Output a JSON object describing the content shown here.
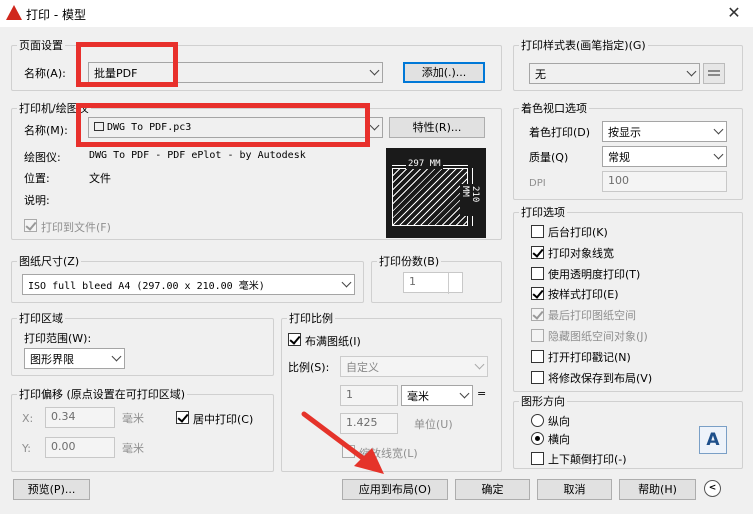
{
  "window": {
    "title": "打印 - 模型",
    "close": "✕"
  },
  "page_setup": {
    "group_label": "页面设置",
    "name_label": "名称(A):",
    "name_value": "批量PDF",
    "add_button": "添加(.)..."
  },
  "printer": {
    "group_label": "打印机/绘图仪",
    "name_label": "名称(M):",
    "name_value": "DWG To PDF.pc3",
    "properties_button": "特性(R)...",
    "plotter_label": "绘图仪:",
    "plotter_value": "DWG To PDF - PDF ePlot - by Autodesk",
    "location_label": "位置:",
    "location_value": "文件",
    "description_label": "说明:",
    "print_to_file": "打印到文件(F)",
    "preview_width": "297 MM",
    "preview_height": "210 MM"
  },
  "paper_size": {
    "group_label": "图纸尺寸(Z)",
    "value": "ISO full bleed A4 (297.00 x 210.00 毫米)"
  },
  "copies": {
    "group_label": "打印份数(B)",
    "value": "1"
  },
  "plot_area": {
    "group_label": "打印区域",
    "range_label": "打印范围(W):",
    "range_value": "图形界限"
  },
  "plot_offset": {
    "group_label": "打印偏移 (原点设置在可打印区域)",
    "x_label": "X:",
    "x_value": "0.34",
    "x_unit": "毫米",
    "y_label": "Y:",
    "y_value": "0.00",
    "y_unit": "毫米",
    "center_plot": "居中打印(C)"
  },
  "plot_scale": {
    "group_label": "打印比例",
    "fit_to_paper": "布满图纸(I)",
    "scale_label": "比例(S):",
    "scale_value": "自定义",
    "value1": "1",
    "unit_value": "毫米",
    "equals": "=",
    "value2": "1.425",
    "unit_label": "单位(U)",
    "scale_lineweights": "缩放线宽(L)"
  },
  "plot_style": {
    "group_label": "打印样式表(画笔指定)(G)",
    "value": "无"
  },
  "shaded_viewport": {
    "group_label": "着色视口选项",
    "shade_label": "着色打印(D)",
    "shade_value": "按显示",
    "quality_label": "质量(Q)",
    "quality_value": "常规",
    "dpi_label": "DPI",
    "dpi_value": "100"
  },
  "plot_options": {
    "group_label": "打印选项",
    "items": [
      {
        "label": "后台打印(K)",
        "checked": false,
        "enabled": true
      },
      {
        "label": "打印对象线宽",
        "checked": true,
        "enabled": true
      },
      {
        "label": "使用透明度打印(T)",
        "checked": false,
        "enabled": true
      },
      {
        "label": "按样式打印(E)",
        "checked": true,
        "enabled": true
      },
      {
        "label": "最后打印图纸空间",
        "checked": true,
        "enabled": false
      },
      {
        "label": "隐藏图纸空间对象(J)",
        "checked": false,
        "enabled": false
      },
      {
        "label": "打开打印戳记(N)",
        "checked": false,
        "enabled": true
      },
      {
        "label": "将修改保存到布局(V)",
        "checked": false,
        "enabled": true
      }
    ]
  },
  "orientation": {
    "group_label": "图形方向",
    "portrait": "纵向",
    "landscape": "横向",
    "upside_down": "上下颠倒打印(-)",
    "selected": "landscape",
    "icon_letter": "A"
  },
  "buttons": {
    "preview": "预览(P)...",
    "apply_layout": "应用到布局(O)",
    "ok": "确定",
    "cancel": "取消",
    "help": "帮助(H)"
  },
  "colors": {
    "highlight": "#e8302c",
    "arrow": "#e5332a",
    "focus": "#0078d7"
  }
}
